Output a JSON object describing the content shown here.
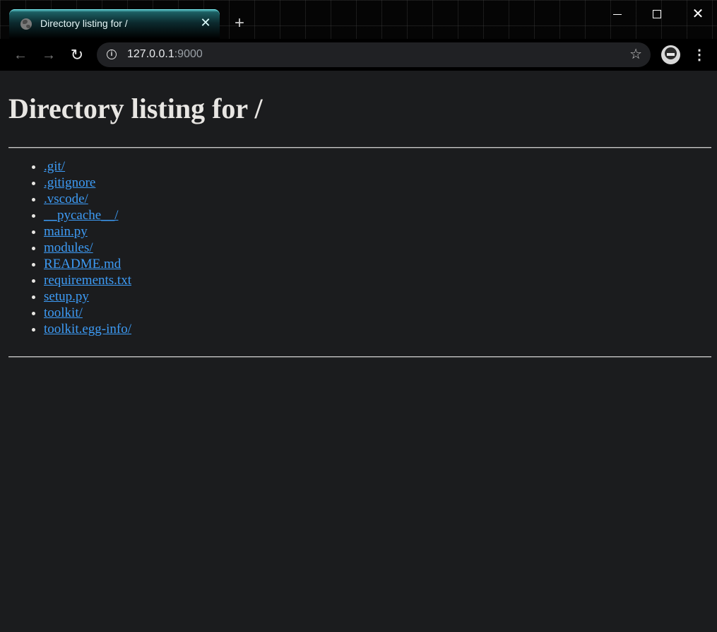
{
  "window": {
    "tab_title": "Directory listing for /",
    "tab_close_glyph": "✕",
    "new_tab_glyph": "+",
    "close_glyph": "✕"
  },
  "toolbar": {
    "back_glyph": "←",
    "forward_glyph": "→",
    "reload_glyph": "↻",
    "url_host": "127.0.0.1",
    "url_port": ":9000",
    "star_glyph": "☆",
    "menu_glyph": "⋮",
    "info_glyph": "i"
  },
  "page": {
    "heading": "Directory listing for /",
    "entries": [
      ".git/",
      ".gitignore",
      ".vscode/",
      "__pycache__/",
      "main.py",
      "modules/",
      "README.md",
      "requirements.txt",
      "setup.py",
      "toolkit/",
      "toolkit.egg-info/"
    ]
  },
  "colors": {
    "page_background": "#1b1c1e",
    "link": "#3d9bf5",
    "text": "#e8e6e3",
    "tab_accent": "#5fd0d4"
  }
}
